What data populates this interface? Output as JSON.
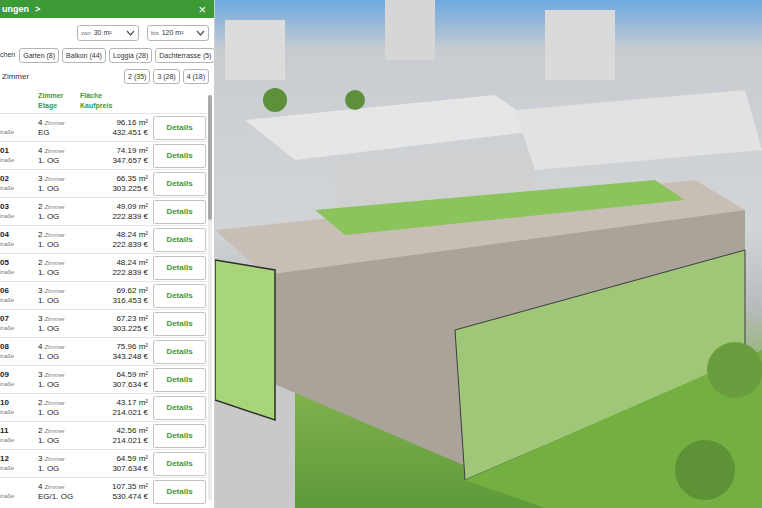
{
  "panel": {
    "header": {
      "title": "ungen",
      "chevron": ">",
      "close": "×"
    },
    "area_from": {
      "prefix": "von",
      "value": "30 m²"
    },
    "area_to": {
      "prefix": "bis",
      "value": "120 m²"
    },
    "features": {
      "label": "chen",
      "chips": [
        "Garten (8)",
        "Balkon (44)",
        "Loggia (28)",
        "Dachterrasse (5)"
      ]
    },
    "rooms": {
      "label": "Zimmer",
      "chips": [
        "2 (35)",
        "3 (28)",
        "4 (18)"
      ]
    },
    "columns": [
      [
        "Zimmer",
        "Etage"
      ],
      [
        "Fläche",
        "Kaufpreis"
      ]
    ],
    "rows": [
      {
        "id": "",
        "street": "traße",
        "rooms": "4",
        "unit": "Zimmer",
        "floor": "EG",
        "area": "96.16 m²",
        "price": "432.451 €",
        "button": "Details"
      },
      {
        "id": "01",
        "street": "traße",
        "rooms": "4",
        "unit": "Zimmer",
        "floor": "1. OG",
        "area": "74.19 m²",
        "price": "347.657 €",
        "button": "Details"
      },
      {
        "id": "02",
        "street": "traße",
        "rooms": "3",
        "unit": "Zimmer",
        "floor": "1. OG",
        "area": "66.35 m²",
        "price": "303.225 €",
        "button": "Details"
      },
      {
        "id": "03",
        "street": "traße",
        "rooms": "2",
        "unit": "Zimmer",
        "floor": "1. OG",
        "area": "49.09 m²",
        "price": "222.839 €",
        "button": "Details"
      },
      {
        "id": "04",
        "street": "traße",
        "rooms": "2",
        "unit": "Zimmer",
        "floor": "1. OG",
        "area": "48.24 m²",
        "price": "222.839 €",
        "button": "Details"
      },
      {
        "id": "05",
        "street": "traße",
        "rooms": "2",
        "unit": "Zimmer",
        "floor": "1. OG",
        "area": "48.24 m²",
        "price": "222.839 €",
        "button": "Details"
      },
      {
        "id": "06",
        "street": "traße",
        "rooms": "3",
        "unit": "Zimmer",
        "floor": "1. OG",
        "area": "69.62 m²",
        "price": "316.453 €",
        "button": "Details"
      },
      {
        "id": "07",
        "street": "traße",
        "rooms": "3",
        "unit": "Zimmer",
        "floor": "1. OG",
        "area": "67.23 m²",
        "price": "303.225 €",
        "button": "Details"
      },
      {
        "id": "08",
        "street": "traße",
        "rooms": "4",
        "unit": "Zimmer",
        "floor": "1. OG",
        "area": "75.96 m²",
        "price": "343.248 €",
        "button": "Details"
      },
      {
        "id": "09",
        "street": "traße",
        "rooms": "3",
        "unit": "Zimmer",
        "floor": "1. OG",
        "area": "64.59 m²",
        "price": "307.634 €",
        "button": "Details"
      },
      {
        "id": "10",
        "street": "traße",
        "rooms": "2",
        "unit": "Zimmer",
        "floor": "1. OG",
        "area": "43.17 m²",
        "price": "214.021 €",
        "button": "Details"
      },
      {
        "id": "11",
        "street": "traße",
        "rooms": "2",
        "unit": "Zimmer",
        "floor": "1. OG",
        "area": "42.56 m²",
        "price": "214.021 €",
        "button": "Details"
      },
      {
        "id": "12",
        "street": "traße",
        "rooms": "3",
        "unit": "Zimmer",
        "floor": "1. OG",
        "area": "64.59 m²",
        "price": "307.634 €",
        "button": "Details"
      },
      {
        "id": "",
        "street": "traße",
        "rooms": "4",
        "unit": "Zimmer",
        "floor": "EG/1. OG",
        "area": "107.35 m²",
        "price": "530.474 €",
        "button": "Details"
      }
    ]
  }
}
